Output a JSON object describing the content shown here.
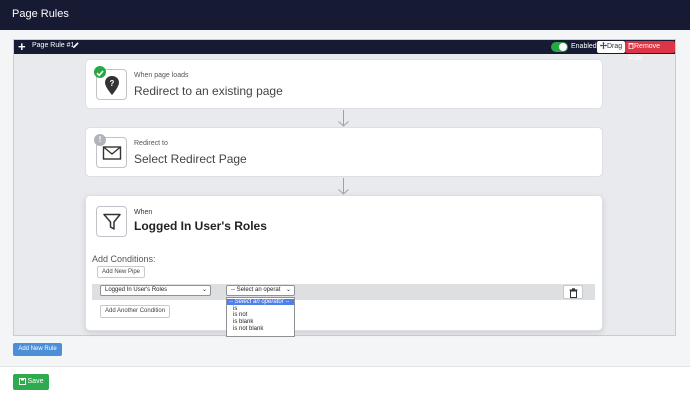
{
  "header": {
    "title": "Page Rules"
  },
  "rule": {
    "add_icon": "+",
    "title": "Page Rule #1",
    "pencil_icon": "pencil-icon",
    "enabled": true,
    "enabled_label": "Enabled",
    "drag_label": "Drag",
    "remove_label": "Remove Rule"
  },
  "trigger": {
    "label": "When page loads",
    "title": "Redirect to an existing page",
    "status": "complete",
    "status_color": "#28a745",
    "icon": "location-question-icon"
  },
  "action": {
    "label": "Redirect to",
    "title": "Select Redirect Page",
    "status": "info",
    "status_color": "#b0b3b8",
    "icon": "envelope-icon"
  },
  "condition": {
    "label": "When",
    "title": "Logged In User's Roles",
    "icon": "filter-icon",
    "add_conditions_label": "Add Conditions:",
    "add_pipe_label": "Add New Pipe",
    "field_select_value": "Logged In User's Roles",
    "operator_select_value": "-- Select an operat",
    "operator_options": [
      "-- Select an operator --",
      "is",
      "is not",
      "is blank",
      "is not blank"
    ],
    "add_another_label": "Add Another Condition"
  },
  "footer": {
    "add_rule_label": "Add New Rule",
    "save_label": "Save"
  },
  "colors": {
    "header": "#161a33",
    "primary": "#4c8fd9",
    "success": "#2eab4f",
    "danger": "#dc3545"
  }
}
